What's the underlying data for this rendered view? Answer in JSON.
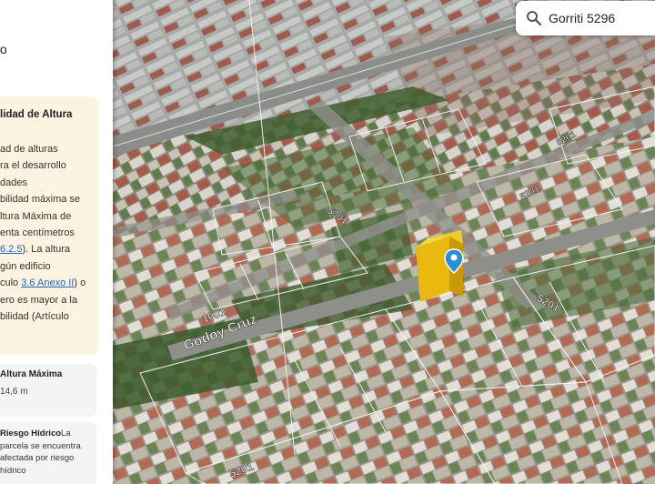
{
  "panel": {
    "title": "to",
    "main_card": {
      "title": "lidad de Altura",
      "lines": [
        {
          "text": "ad de alturas"
        },
        {
          "text": "ra el desarrollo"
        },
        {
          "text": "dades"
        },
        {
          "text": "bilidad máxima se"
        },
        {
          "text": "ltura Máxima de"
        },
        {
          "text": "enta centímetros"
        },
        {
          "pre": "",
          "link": "6.2.5",
          "post": "). La altura"
        },
        {
          "text": "gún edificio"
        },
        {
          "pre": "culo ",
          "link": "3.6 Anexo II",
          "post": ") o"
        },
        {
          "text": "ero es mayor a la"
        },
        {
          "text": "bilidad (Artículo"
        }
      ]
    },
    "altura_card": {
      "title": "Altura Máxima",
      "value": "14,6 m"
    },
    "riesgo_card": {
      "title": "Riesgo Hídrico",
      "text": "La parcela se encuentra afectada por riesgo hídrico"
    }
  },
  "search": {
    "value": "Gorriti 5296",
    "placeholder": ""
  },
  "map": {
    "street_labels": [
      "Godoy Cruz",
      "1601",
      "5301",
      "5201",
      "5201",
      "5201",
      "5201"
    ],
    "marker_color": "#2b8fd6",
    "building_color": "#f2c618"
  }
}
